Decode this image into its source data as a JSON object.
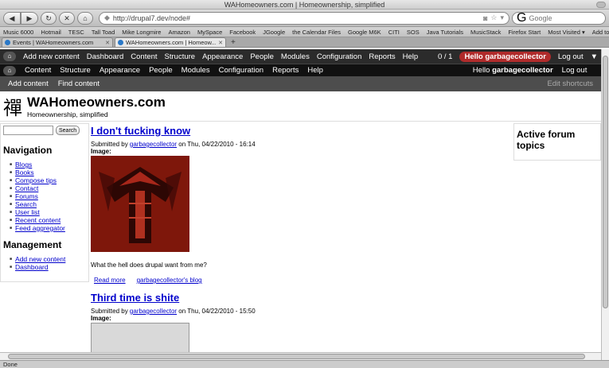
{
  "window": {
    "title": "WAHomeowners.com | Homeownership, simplified"
  },
  "browser": {
    "back_icon": "◀",
    "forward_icon": "▶",
    "reload_icon": "↻",
    "stop_icon": "✕",
    "home_icon": "⌂",
    "url": "http://drupal7.dev/node#",
    "search_placeholder": "Google",
    "status": "Done"
  },
  "bookmarks": [
    "Music 6000",
    "Hotmail",
    "TESC",
    "Tall Toad",
    "Mike Longmire",
    "Amazon",
    "MySpace",
    "Facebook",
    "JGoogle",
    "the Calendar Files",
    "Google M6K",
    "CITI",
    "SOS",
    "Java Tutorials",
    "MusicStack",
    "Firefox Start",
    "Most Visited ▾",
    "Add to Wish List"
  ],
  "tabs": [
    {
      "label": "Events | WAHomeowners.com",
      "active": false
    },
    {
      "label": "WAHomeowners.com | Homeow...",
      "active": true
    }
  ],
  "newtab_icon": "+",
  "admin_toolbar": {
    "home_icon": "⌂",
    "items": [
      "Add new content",
      "Dashboard",
      "Content",
      "Structure",
      "Appearance",
      "People",
      "Modules",
      "Configuration",
      "Reports",
      "Help"
    ],
    "counter": "0 / 1",
    "user": "Hello garbagecollector",
    "logout": "Log out"
  },
  "admin_menu": {
    "items": [
      "Content",
      "Structure",
      "Appearance",
      "People",
      "Modules",
      "Configuration",
      "Reports",
      "Help"
    ],
    "hello": "Hello",
    "username": "garbagecollector",
    "logout": "Log out"
  },
  "shortcuts": {
    "items": [
      "Add content",
      "Find content"
    ],
    "edit": "Edit shortcuts"
  },
  "site": {
    "logo_glyph": "禪",
    "name": "WAHomeowners.com",
    "slogan": "Homeownership, simplified"
  },
  "sidebar": {
    "search_button": "Search",
    "navigation_title": "Navigation",
    "navigation": [
      "Blogs",
      "Books",
      "Compose tips",
      "Contact",
      "Forums",
      "Search",
      "User list",
      "Recent content",
      "Feed aggregator"
    ],
    "management_title": "Management",
    "management": [
      "Add new content",
      "Dashboard"
    ]
  },
  "nodes": [
    {
      "title": "I don't fucking know",
      "submitted_prefix": "Submitted by ",
      "author": "garbagecollector",
      "date": " on Thu, 04/22/2010 - 16:14",
      "image_label": "Image:",
      "body": "What the hell does drupal want from me?",
      "read_more": "Read more",
      "blog_link": "garbagecollector's blog"
    },
    {
      "title": "Third time is shite",
      "submitted_prefix": "Submitted by ",
      "author": "garbagecollector",
      "date": " on Thu, 04/22/2010 - 15:50",
      "image_label": "Image:"
    }
  ],
  "right_block": {
    "title": "Active forum topics"
  },
  "colors": {
    "admin_bar": "#2b2b2b",
    "user_pill": "#b02b2b",
    "link": "#0000cc",
    "image_red": "#8b1a0d"
  }
}
